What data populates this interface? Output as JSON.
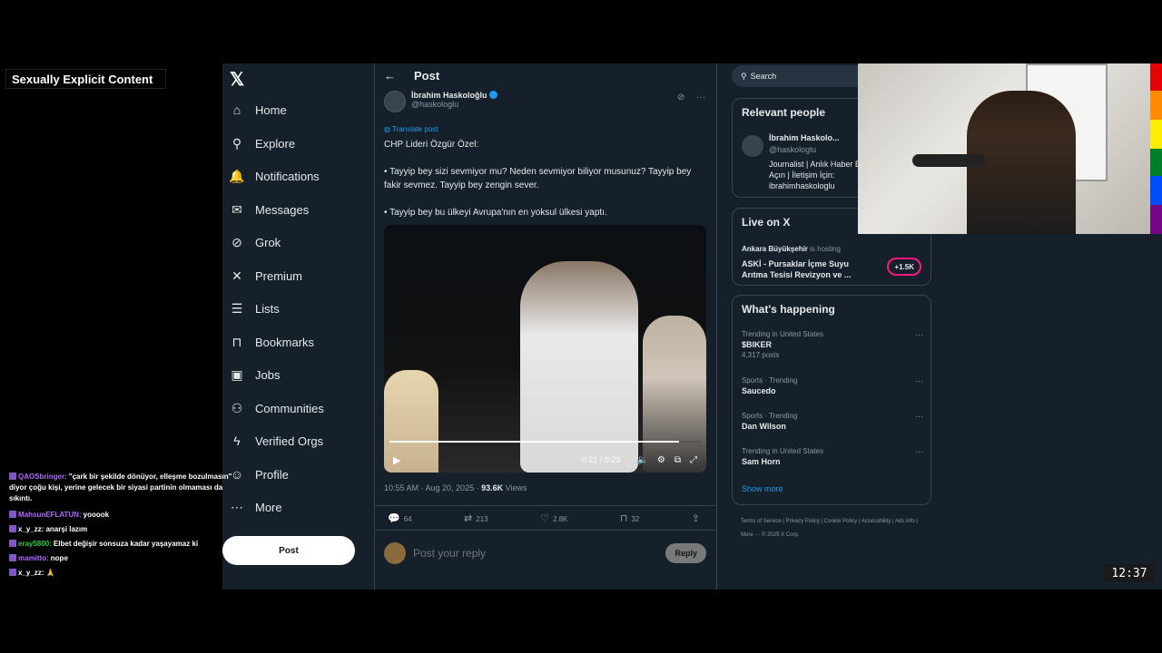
{
  "overlay": {
    "content_warning": "Sexually Explicit Content",
    "clock": "12:37"
  },
  "chat": [
    {
      "user": "QAOSbringer:",
      "user_color": "#b06bff",
      "message": "\"çark bir şekilde dönüyor, elleşme bozulmasın\" diyor çoğu kişi, yerine gelecek bir siyasi partinin olmaması da sıkıntı."
    },
    {
      "user": "MahsunEFLATUN:",
      "user_color": "#b06bff",
      "message": "yooook"
    },
    {
      "user": "x_y_zz:",
      "user_color": "#ffffff",
      "message": "anarşi lazım"
    },
    {
      "user": "eray5800:",
      "user_color": "#2ecc40",
      "message": "Elbet değişir sonsuza kadar yaşayamaz ki"
    },
    {
      "user": "mamitto:",
      "user_color": "#b06bff",
      "message": "nope"
    },
    {
      "user": "x_y_zz:",
      "user_color": "#ffffff",
      "message": "🙏"
    }
  ],
  "nav": {
    "items": [
      {
        "label": "Home",
        "icon": "home-icon",
        "glyph": "⌂"
      },
      {
        "label": "Explore",
        "icon": "search-icon",
        "glyph": "⚲"
      },
      {
        "label": "Notifications",
        "icon": "bell-icon",
        "glyph": "🔔"
      },
      {
        "label": "Messages",
        "icon": "mail-icon",
        "glyph": "✉"
      },
      {
        "label": "Grok",
        "icon": "grok-icon",
        "glyph": "⊘"
      },
      {
        "label": "Premium",
        "icon": "x-logo-icon",
        "glyph": "✕"
      },
      {
        "label": "Lists",
        "icon": "list-icon",
        "glyph": "☰"
      },
      {
        "label": "Bookmarks",
        "icon": "bookmark-icon",
        "glyph": "⊓"
      },
      {
        "label": "Jobs",
        "icon": "briefcase-icon",
        "glyph": "▣"
      },
      {
        "label": "Communities",
        "icon": "people-icon",
        "glyph": "⚇"
      },
      {
        "label": "Verified Orgs",
        "icon": "lightning-icon",
        "glyph": "ϟ"
      },
      {
        "label": "Profile",
        "icon": "person-icon",
        "glyph": "☺"
      },
      {
        "label": "More",
        "icon": "more-circle-icon",
        "glyph": "⋯"
      }
    ],
    "post_button": "Post"
  },
  "main": {
    "title": "Post",
    "author": {
      "name": "İbrahim Haskoloğlu",
      "handle": "@haskologlu"
    },
    "translate": "Translate post",
    "text": "CHP Lideri Özgür Özel:\n\n• Tayyip bey sizi sevmiyor mu? Neden sevmiyor biliyor musunuz? Tayyip bey fakir sevmez. Tayyip bey zengin sever.\n\n• Tayyip bey bu ülkeyi Avrupa'nın en yoksul ülkesi yaptı.",
    "video": {
      "time": "0:21 / 0:23",
      "progress": 0.93
    },
    "meta": {
      "timestamp": "10:55 AM · Aug 20, 2025 · ",
      "views_count": "93.6K",
      "views_label": " Views"
    },
    "actions": {
      "replies": "64",
      "reposts": "213",
      "likes": "2.8K",
      "bookmarks": "32"
    },
    "reply": {
      "placeholder": "Post your reply",
      "button": "Reply"
    }
  },
  "right": {
    "search_placeholder": "Search",
    "relevant": {
      "title": "Relevant people",
      "name": "İbrahim Haskolo...",
      "handle": "@haskologlu",
      "bio": "Journalist | Anlık Haber Bildirimleri Açın | İletişim İçin: ibrahimhaskologlu"
    },
    "live": {
      "title": "Live on X",
      "host": "Ankara Büyükşehir",
      "hosting": " is hosting",
      "stream": "ASKİ - Pursaklar İçme Suyu Arıtma Tesisi Revizyon ve ...",
      "count": "+1.5K"
    },
    "happening": {
      "title": "What's happening",
      "trends": [
        {
          "context": "Trending in United States",
          "topic": "$BIKER",
          "posts": "4,317 posts"
        },
        {
          "context": "Sports · Trending",
          "topic": "Saucedo",
          "posts": ""
        },
        {
          "context": "Sports · Trending",
          "topic": "Dan Wilson",
          "posts": ""
        },
        {
          "context": "Trending in United States",
          "topic": "Sam Horn",
          "posts": ""
        }
      ],
      "show_more": "Show more"
    },
    "footer": "Terms of Service  |  Privacy Policy  |  Cookie Policy  |  Accessibility  |  Ads info  |  More ···  © 2025 X Corp."
  }
}
